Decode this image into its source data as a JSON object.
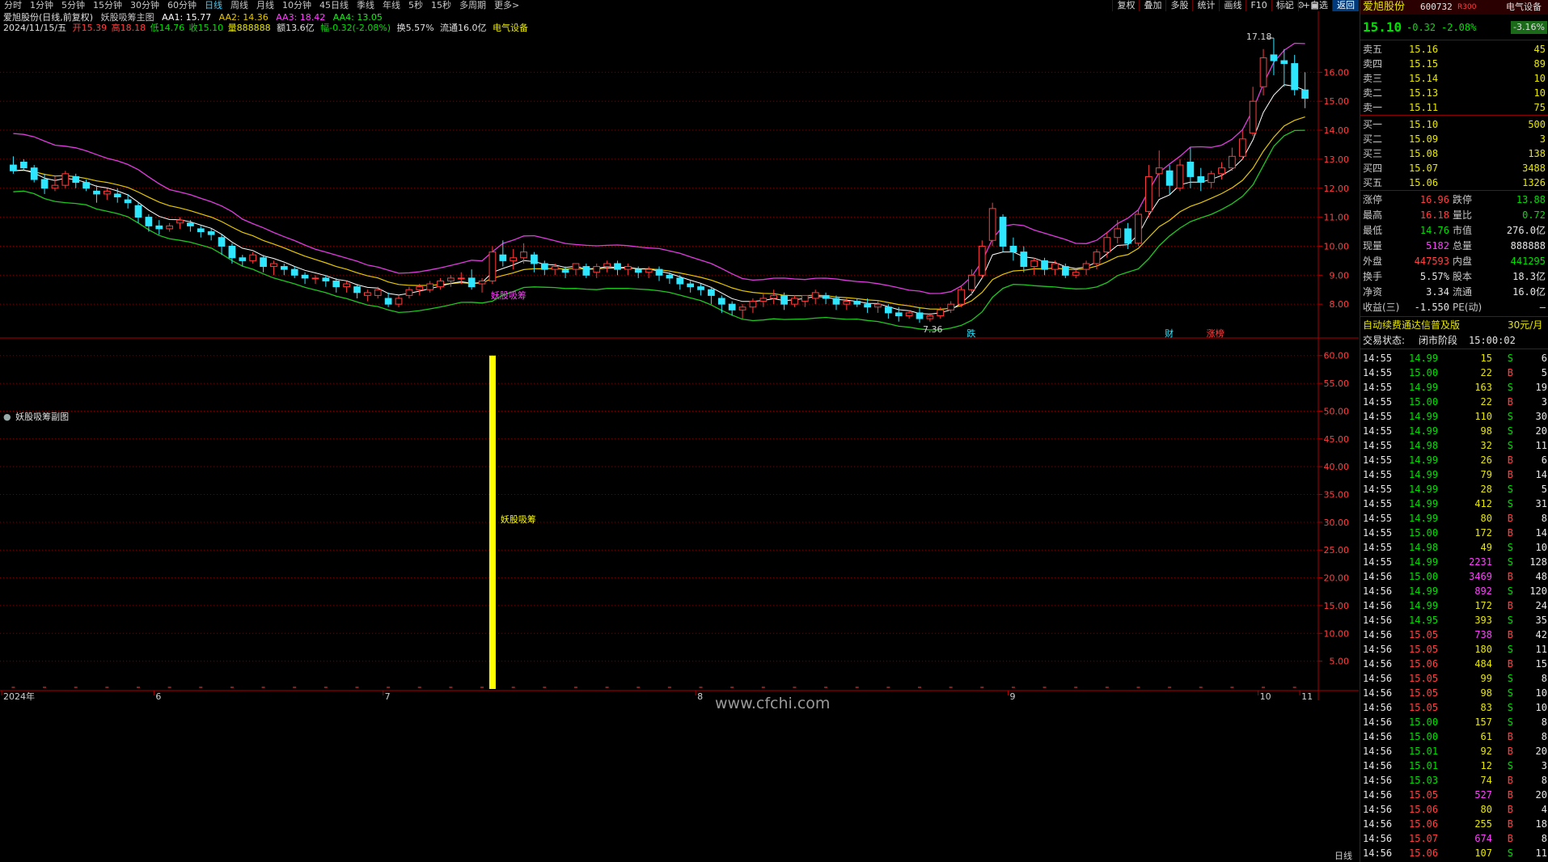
{
  "toolbar": {
    "tabs": [
      "分时",
      "1分钟",
      "5分钟",
      "15分钟",
      "30分钟",
      "60分钟",
      "日线",
      "周线",
      "月线",
      "10分钟",
      "45日线",
      "季线",
      "年线",
      "5秒",
      "15秒",
      "多周期",
      "更多>"
    ],
    "active_tab": "日线",
    "tools": [
      "复权",
      "叠加",
      "多股",
      "统计",
      "画线",
      "F10",
      "标记",
      "+自选",
      "返回"
    ],
    "highlight_tool": "返回",
    "icons": [
      "◇",
      "⚙",
      "▣"
    ]
  },
  "main_chart": {
    "stock_title": "爱旭股份(日线,前复权)",
    "indicator_name": "妖股吸筹主图",
    "aa1": "AA1: 15.77",
    "aa2": "AA2: 14.36",
    "aa3": "AA3: 18.42",
    "aa4": "AA4: 13.05",
    "info_date": "2024/11/15/五",
    "info_open": "开15.39",
    "info_high": "高18.18",
    "info_low": "低14.76",
    "info_close": "收15.10",
    "info_volume": "量888888",
    "info_amount": "额13.6亿",
    "info_change": "幅-0.32(-2.08%)",
    "info_turnover": "换5.57%",
    "info_float": "流通16.0亿",
    "info_sector": "电气设备",
    "high_marker": "17.18",
    "low_marker": "7.36",
    "signal_label": "妖股吸筹",
    "event_labels": [
      "跌",
      "财",
      "涨榜"
    ]
  },
  "sub_chart": {
    "title": "妖股吸筹副图",
    "bar_label": "妖股吸筹"
  },
  "x_axis": {
    "labels": [
      "2024年",
      "6",
      "7",
      "8",
      "9",
      "10",
      "11"
    ],
    "period_label": "日线"
  },
  "watermark": "www.cfchi.com",
  "colors": {
    "up": "#ff3b3b",
    "down": "#2fe6ff",
    "upper_band": "#e03ce0",
    "mid_line": "#ffffff",
    "ma_line": "#e8c800",
    "lower_band": "#1ec81e",
    "signal_bar": "#ffff00",
    "grid": "#7a0000"
  },
  "chart_data": [
    {
      "type": "candlestick",
      "title": "妖股吸筹主图",
      "y_axis": {
        "ticks": [
          8.0,
          9.0,
          10.0,
          11.0,
          12.0,
          13.0,
          14.0,
          15.0,
          16.0
        ],
        "range": [
          7.0,
          17.6
        ]
      },
      "candles": [
        [
          12.8,
          13.1,
          12.6,
          12.5
        ],
        [
          12.9,
          13.0,
          12.7,
          12.6
        ],
        [
          12.7,
          12.8,
          12.3,
          12.2
        ],
        [
          12.3,
          12.5,
          12.0,
          11.8
        ],
        [
          12.0,
          12.4,
          12.1,
          11.9
        ],
        [
          12.1,
          12.6,
          12.5,
          12.0
        ],
        [
          12.4,
          12.5,
          12.2,
          12.0
        ],
        [
          12.2,
          12.3,
          12.0,
          11.9
        ],
        [
          11.9,
          12.1,
          11.8,
          11.5
        ],
        [
          11.8,
          12.0,
          11.9,
          11.6
        ],
        [
          11.8,
          12.0,
          11.7,
          11.5
        ],
        [
          11.6,
          11.8,
          11.5,
          11.3
        ],
        [
          11.4,
          11.5,
          11.0,
          10.8
        ],
        [
          11.0,
          11.1,
          10.7,
          10.5
        ],
        [
          10.7,
          10.9,
          10.6,
          10.4
        ],
        [
          10.6,
          10.8,
          10.7,
          10.5
        ],
        [
          10.8,
          11.0,
          10.9,
          10.6
        ],
        [
          10.8,
          10.9,
          10.7,
          10.5
        ],
        [
          10.6,
          10.7,
          10.5,
          10.3
        ],
        [
          10.5,
          10.6,
          10.4,
          10.2
        ],
        [
          10.3,
          10.4,
          10.0,
          9.7
        ],
        [
          10.0,
          10.1,
          9.6,
          9.4
        ],
        [
          9.6,
          9.7,
          9.5,
          9.3
        ],
        [
          9.5,
          9.8,
          9.7,
          9.4
        ],
        [
          9.6,
          9.7,
          9.3,
          9.1
        ],
        [
          9.3,
          9.5,
          9.4,
          9.0
        ],
        [
          9.3,
          9.4,
          9.2,
          9.0
        ],
        [
          9.2,
          9.3,
          9.0,
          8.9
        ],
        [
          9.0,
          9.1,
          8.9,
          8.7
        ],
        [
          8.9,
          9.0,
          8.9,
          8.7
        ],
        [
          8.9,
          9.0,
          8.8,
          8.6
        ],
        [
          8.8,
          8.9,
          8.6,
          8.4
        ],
        [
          8.6,
          8.8,
          8.7,
          8.4
        ],
        [
          8.6,
          8.7,
          8.4,
          8.2
        ],
        [
          8.3,
          8.5,
          8.4,
          8.1
        ],
        [
          8.3,
          8.6,
          8.5,
          8.2
        ],
        [
          8.2,
          8.4,
          8.0,
          7.9
        ],
        [
          8.0,
          8.3,
          8.2,
          7.9
        ],
        [
          8.3,
          8.6,
          8.5,
          8.2
        ],
        [
          8.5,
          8.7,
          8.6,
          8.3
        ],
        [
          8.5,
          8.8,
          8.7,
          8.4
        ],
        [
          8.6,
          8.9,
          8.8,
          8.5
        ],
        [
          8.8,
          9.0,
          8.9,
          8.6
        ],
        [
          8.9,
          9.1,
          8.9,
          8.7
        ],
        [
          8.9,
          9.2,
          8.6,
          8.5
        ],
        [
          8.7,
          8.9,
          8.8,
          8.4
        ],
        [
          8.8,
          10.0,
          9.8,
          8.7
        ],
        [
          9.7,
          10.2,
          9.5,
          9.3
        ],
        [
          9.5,
          9.9,
          9.6,
          9.2
        ],
        [
          9.6,
          10.1,
          9.8,
          9.4
        ],
        [
          9.7,
          9.8,
          9.4,
          9.1
        ],
        [
          9.4,
          9.5,
          9.2,
          9.0
        ],
        [
          9.2,
          9.4,
          9.3,
          9.0
        ],
        [
          9.2,
          9.3,
          9.1,
          8.9
        ],
        [
          9.2,
          9.4,
          9.4,
          9.0
        ],
        [
          9.3,
          9.4,
          9.0,
          8.9
        ],
        [
          9.1,
          9.4,
          9.3,
          8.9
        ],
        [
          9.3,
          9.5,
          9.4,
          9.1
        ],
        [
          9.4,
          9.5,
          9.2,
          9.0
        ],
        [
          9.2,
          9.4,
          9.3,
          9.0
        ],
        [
          9.2,
          9.3,
          9.1,
          8.9
        ],
        [
          9.1,
          9.3,
          9.2,
          8.9
        ],
        [
          9.2,
          9.3,
          9.0,
          8.8
        ],
        [
          9.0,
          9.1,
          8.9,
          8.7
        ],
        [
          8.9,
          9.0,
          8.7,
          8.5
        ],
        [
          8.7,
          8.8,
          8.6,
          8.4
        ],
        [
          8.6,
          8.7,
          8.5,
          8.3
        ],
        [
          8.5,
          8.6,
          8.3,
          8.0
        ],
        [
          8.2,
          8.3,
          8.0,
          7.7
        ],
        [
          8.0,
          8.1,
          7.8,
          7.6
        ],
        [
          7.8,
          8.0,
          7.9,
          7.5
        ],
        [
          7.9,
          8.2,
          8.1,
          7.7
        ],
        [
          8.1,
          8.4,
          8.2,
          7.9
        ],
        [
          8.2,
          8.5,
          8.3,
          8.0
        ],
        [
          8.3,
          8.4,
          8.0,
          7.8
        ],
        [
          8.0,
          8.3,
          8.2,
          7.9
        ],
        [
          8.1,
          8.3,
          8.3,
          7.9
        ],
        [
          8.2,
          8.5,
          8.4,
          8.0
        ],
        [
          8.3,
          8.4,
          8.2,
          8.0
        ],
        [
          8.2,
          8.3,
          8.0,
          7.8
        ],
        [
          8.0,
          8.2,
          8.1,
          7.8
        ],
        [
          8.1,
          8.2,
          8.0,
          7.9
        ],
        [
          8.0,
          8.2,
          7.9,
          7.7
        ],
        [
          7.9,
          8.1,
          8.0,
          7.7
        ],
        [
          7.9,
          8.0,
          7.7,
          7.5
        ],
        [
          7.7,
          7.9,
          7.6,
          7.4
        ],
        [
          7.6,
          7.8,
          7.7,
          7.5
        ],
        [
          7.7,
          7.9,
          7.5,
          7.36
        ],
        [
          7.5,
          7.7,
          7.6,
          7.4
        ],
        [
          7.6,
          7.9,
          7.8,
          7.5
        ],
        [
          7.8,
          8.1,
          8.0,
          7.7
        ],
        [
          8.0,
          8.6,
          8.5,
          7.9
        ],
        [
          8.5,
          9.2,
          9.0,
          8.3
        ],
        [
          9.0,
          10.2,
          10.0,
          8.9
        ],
        [
          10.2,
          11.5,
          11.3,
          10.0
        ],
        [
          11.0,
          11.1,
          10.0,
          9.8
        ],
        [
          10.0,
          10.3,
          9.8,
          9.5
        ],
        [
          9.8,
          10.0,
          9.3,
          9.1
        ],
        [
          9.3,
          9.6,
          9.5,
          9.0
        ],
        [
          9.5,
          9.6,
          9.2,
          9.0
        ],
        [
          9.2,
          9.5,
          9.4,
          9.0
        ],
        [
          9.3,
          9.4,
          9.0,
          8.9
        ],
        [
          9.0,
          9.2,
          9.1,
          8.9
        ],
        [
          9.2,
          9.5,
          9.4,
          9.0
        ],
        [
          9.4,
          9.9,
          9.8,
          9.2
        ],
        [
          9.8,
          10.5,
          10.3,
          9.6
        ],
        [
          10.3,
          10.9,
          10.6,
          10.1
        ],
        [
          10.6,
          10.8,
          10.1,
          9.9
        ],
        [
          10.1,
          11.3,
          11.1,
          10.0
        ],
        [
          11.2,
          12.8,
          12.4,
          11.0
        ],
        [
          12.5,
          13.3,
          12.7,
          11.7
        ],
        [
          12.6,
          12.8,
          12.1,
          11.8
        ],
        [
          12.0,
          13.0,
          12.8,
          11.9
        ],
        [
          12.9,
          13.4,
          12.4,
          12.0
        ],
        [
          12.4,
          12.7,
          12.2,
          11.9
        ],
        [
          12.2,
          12.6,
          12.5,
          12.0
        ],
        [
          12.5,
          12.9,
          12.7,
          12.3
        ],
        [
          12.7,
          13.4,
          13.1,
          12.6
        ],
        [
          13.1,
          14.0,
          13.7,
          13.0
        ],
        [
          13.9,
          15.5,
          15.0,
          13.8
        ],
        [
          15.5,
          16.8,
          16.5,
          15.2
        ],
        [
          16.6,
          17.18,
          16.4,
          15.9
        ],
        [
          16.4,
          16.8,
          16.3,
          15.5
        ],
        [
          16.3,
          16.6,
          15.4,
          15.2
        ],
        [
          15.39,
          16.0,
          15.1,
          14.76
        ]
      ],
      "series": [
        {
          "name": "AA1",
          "note": "mid line"
        },
        {
          "name": "AA2",
          "note": "ma line"
        },
        {
          "name": "AA3",
          "note": "upper band"
        },
        {
          "name": "AA4",
          "note": "lower band"
        }
      ]
    },
    {
      "type": "bar",
      "title": "妖股吸筹副图",
      "y_axis": {
        "ticks": [
          5.0,
          10.0,
          15.0,
          20.0,
          25.0,
          30.0,
          35.0,
          40.0,
          45.0,
          50.0,
          55.0,
          60.0
        ],
        "range": [
          0,
          62
        ]
      },
      "bars": [
        {
          "index": 46,
          "value": 60.0,
          "label": "妖股吸筹"
        }
      ]
    }
  ],
  "panel": {
    "stock_name": "爱旭股份",
    "stock_code": "600732",
    "rating_tag": "R",
    "rating_num": "300",
    "sector": "电气设备",
    "sector_change": "-3.16%",
    "price": "15.10",
    "change": "-0.32",
    "change_pct": "-2.08%",
    "asks": [
      {
        "label": "卖五",
        "price": "15.16",
        "vol": "45"
      },
      {
        "label": "卖四",
        "price": "15.15",
        "vol": "89"
      },
      {
        "label": "卖三",
        "price": "15.14",
        "vol": "10"
      },
      {
        "label": "卖二",
        "price": "15.13",
        "vol": "10"
      },
      {
        "label": "卖一",
        "price": "15.11",
        "vol": "75"
      }
    ],
    "bids": [
      {
        "label": "买一",
        "price": "15.10",
        "vol": "500"
      },
      {
        "label": "买二",
        "price": "15.09",
        "vol": "3"
      },
      {
        "label": "买三",
        "price": "15.08",
        "vol": "138"
      },
      {
        "label": "买四",
        "price": "15.07",
        "vol": "3488"
      },
      {
        "label": "买五",
        "price": "15.06",
        "vol": "1326"
      }
    ],
    "stats": [
      {
        "l1": "涨停",
        "v1": "16.96",
        "c1": "red",
        "l2": "跌停",
        "v2": "13.88",
        "c2": "green"
      },
      {
        "l1": "最高",
        "v1": "16.18",
        "c1": "red",
        "l2": "量比",
        "v2": "0.72",
        "c2": "green"
      },
      {
        "l1": "最低",
        "v1": "14.76",
        "c1": "green",
        "l2": "市值",
        "v2": "276.0亿",
        "c2": "white"
      },
      {
        "l1": "现量",
        "v1": "5182",
        "c1": "mag",
        "l2": "总量",
        "v2": "888888",
        "c2": "white"
      },
      {
        "l1": "外盘",
        "v1": "447593",
        "c1": "red",
        "l2": "内盘",
        "v2": "441295",
        "c2": "green"
      },
      {
        "l1": "换手",
        "v1": "5.57%",
        "c1": "white",
        "l2": "股本",
        "v2": "18.3亿",
        "c2": "white"
      },
      {
        "l1": "净资",
        "v1": "3.34",
        "c1": "white",
        "l2": "流通",
        "v2": "16.0亿",
        "c2": "white"
      },
      {
        "l1": "收益(三)",
        "v1": "-1.550",
        "c1": "white",
        "l2": "PE(动)",
        "v2": "–",
        "c2": "white"
      }
    ],
    "ad_text": "自动续费通达信普及版",
    "ad_price": "30元/月",
    "status_label": "交易状态:",
    "status_value": "闭市阶段",
    "status_time": "15:00:02",
    "trades": [
      [
        "14:55",
        "14.99",
        "15",
        "S",
        "6"
      ],
      [
        "14:55",
        "15.00",
        "22",
        "B",
        "5"
      ],
      [
        "14:55",
        "14.99",
        "163",
        "S",
        "19"
      ],
      [
        "14:55",
        "15.00",
        "22",
        "B",
        "3"
      ],
      [
        "14:55",
        "14.99",
        "110",
        "S",
        "30"
      ],
      [
        "14:55",
        "14.99",
        "98",
        "S",
        "20"
      ],
      [
        "14:55",
        "14.98",
        "32",
        "S",
        "11"
      ],
      [
        "14:55",
        "14.99",
        "26",
        "B",
        "6"
      ],
      [
        "14:55",
        "14.99",
        "79",
        "B",
        "14"
      ],
      [
        "14:55",
        "14.99",
        "28",
        "S",
        "5"
      ],
      [
        "14:55",
        "14.99",
        "412",
        "S",
        "31"
      ],
      [
        "14:55",
        "14.99",
        "80",
        "B",
        "8"
      ],
      [
        "14:55",
        "15.00",
        "172",
        "B",
        "14"
      ],
      [
        "14:55",
        "14.98",
        "49",
        "S",
        "10"
      ],
      [
        "14:55",
        "14.99",
        "2231",
        "S",
        "128"
      ],
      [
        "14:56",
        "15.00",
        "3469",
        "B",
        "48"
      ],
      [
        "14:56",
        "14.99",
        "892",
        "S",
        "120"
      ],
      [
        "14:56",
        "14.99",
        "172",
        "B",
        "24"
      ],
      [
        "14:56",
        "14.95",
        "393",
        "S",
        "35"
      ],
      [
        "14:56",
        "15.05",
        "738",
        "B",
        "42"
      ],
      [
        "14:56",
        "15.05",
        "180",
        "S",
        "11"
      ],
      [
        "14:56",
        "15.06",
        "484",
        "B",
        "15"
      ],
      [
        "14:56",
        "15.05",
        "99",
        "S",
        "8"
      ],
      [
        "14:56",
        "15.05",
        "98",
        "S",
        "10"
      ],
      [
        "14:56",
        "15.05",
        "83",
        "S",
        "10"
      ],
      [
        "14:56",
        "15.00",
        "157",
        "S",
        "8"
      ],
      [
        "14:56",
        "15.00",
        "61",
        "B",
        "8"
      ],
      [
        "14:56",
        "15.01",
        "92",
        "B",
        "20"
      ],
      [
        "14:56",
        "15.01",
        "12",
        "S",
        "3"
      ],
      [
        "14:56",
        "15.03",
        "74",
        "B",
        "8"
      ],
      [
        "14:56",
        "15.05",
        "527",
        "B",
        "20"
      ],
      [
        "14:56",
        "15.06",
        "80",
        "B",
        "4"
      ],
      [
        "14:56",
        "15.06",
        "255",
        "B",
        "18"
      ],
      [
        "14:56",
        "15.07",
        "674",
        "B",
        "8"
      ],
      [
        "14:56",
        "15.06",
        "107",
        "S",
        "11"
      ]
    ]
  }
}
